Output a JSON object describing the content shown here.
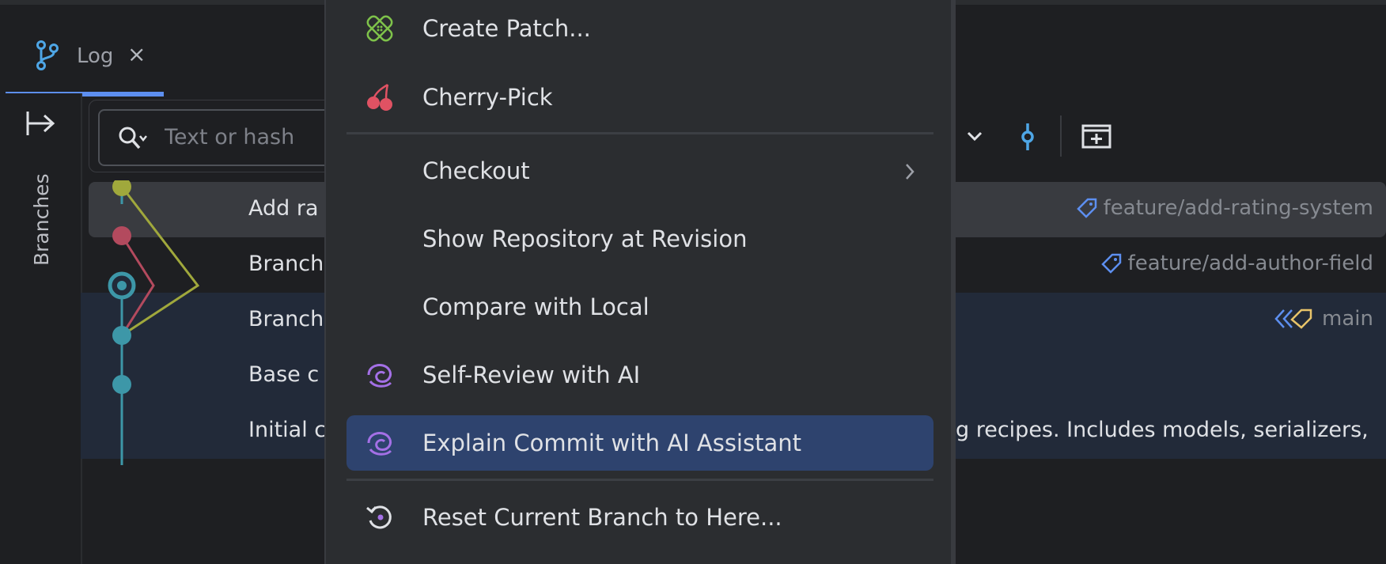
{
  "tabs": [
    {
      "label": "Log",
      "icon": "git-branch-icon",
      "close": "×",
      "active": true
    }
  ],
  "sidebar": {
    "label": "Branches",
    "toggle_icon": "expand-panel-icon"
  },
  "search": {
    "placeholder": "Text or hash",
    "value": ""
  },
  "toolbar": {
    "icons": [
      "chevron-down-icon",
      "commit-node-icon",
      "new-tab-icon"
    ]
  },
  "commits": [
    {
      "message": "Add ra",
      "ref": "feature/add-rating-system",
      "ref_icon": "tag-icon",
      "color": "#a0a83c"
    },
    {
      "message": "Branch",
      "ref": "feature/add-author-field",
      "ref_icon": "tag-icon",
      "color": "#b34a5e"
    },
    {
      "message": "Branch",
      "ref": "main",
      "ref_icon": "main-branch-tags-icon",
      "color": "#3d97a8",
      "head": true
    },
    {
      "message": "Base c",
      "ref": "",
      "color": "#3d97a8"
    },
    {
      "message": "Initial c",
      "suffix": "g recipes. Includes models, serializers,",
      "ref": "",
      "color": "#3d97a8"
    }
  ],
  "context_menu": {
    "items": [
      {
        "label": "Create Patch...",
        "icon": "patch-icon",
        "group": 1
      },
      {
        "label": "Cherry-Pick",
        "icon": "cherry-icon",
        "group": 1
      },
      {
        "label": "Checkout",
        "icon": "",
        "submenu": true,
        "group": 2
      },
      {
        "label": "Show Repository at Revision",
        "icon": "",
        "group": 2
      },
      {
        "label": "Compare with Local",
        "icon": "",
        "group": 2
      },
      {
        "label": "Self-Review with AI",
        "icon": "ai-spiral-icon",
        "group": 2
      },
      {
        "label": "Explain Commit with AI Assistant",
        "icon": "ai-spiral-icon",
        "selected": true,
        "group": 2
      },
      {
        "label": "Reset Current Branch to Here...",
        "icon": "reset-icon",
        "group": 3
      }
    ]
  },
  "colors": {
    "background": "#1e1f22",
    "menu": "#2b2d30",
    "selection": "#2e436e",
    "accent": "#5d8ff0",
    "highlight_rows": "#222a39"
  }
}
